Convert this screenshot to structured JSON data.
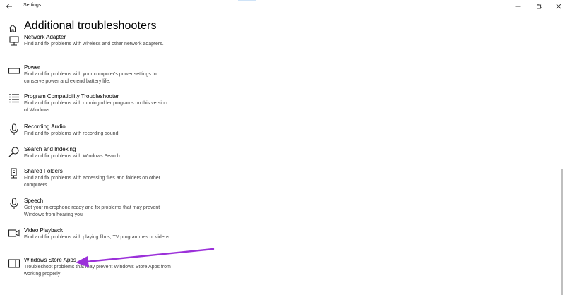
{
  "window": {
    "title": "Settings"
  },
  "header": {
    "title": "Additional troubleshooters"
  },
  "troubleshooters": [
    {
      "name": "Network Adapter",
      "description": "Find and fix problems with wireless and other network adapters.",
      "icon": "network-adapter-icon"
    },
    {
      "name": "Power",
      "description": "Find and fix problems with your computer's power settings to conserve power and extend battery life.",
      "icon": "battery-icon"
    },
    {
      "name": "Program Compatibility Troubleshooter",
      "description": "Find and fix problems with running older programs on this version of Windows.",
      "icon": "list-icon"
    },
    {
      "name": "Recording Audio",
      "description": "Find and fix problems with recording sound",
      "icon": "microphone-icon"
    },
    {
      "name": "Search and Indexing",
      "description": "Find and fix problems with Windows Search",
      "icon": "search-icon"
    },
    {
      "name": "Shared Folders",
      "description": "Find and fix problems with accessing files and folders on other computers.",
      "icon": "shared-folder-icon"
    },
    {
      "name": "Speech",
      "description": "Get your microphone ready and fix problems that may prevent Windows from hearing you",
      "icon": "microphone-icon"
    },
    {
      "name": "Video Playback",
      "description": "Find and fix problems with playing films, TV programmes or videos",
      "icon": "video-camera-icon"
    },
    {
      "name": "Windows Store Apps",
      "description": "Troubleshoot problems that may prevent Windows Store Apps from working properly",
      "icon": "store-app-icon"
    }
  ],
  "colors": {
    "annotation_arrow": "#9b30d9",
    "scrollbar": "#bfbfbf"
  }
}
